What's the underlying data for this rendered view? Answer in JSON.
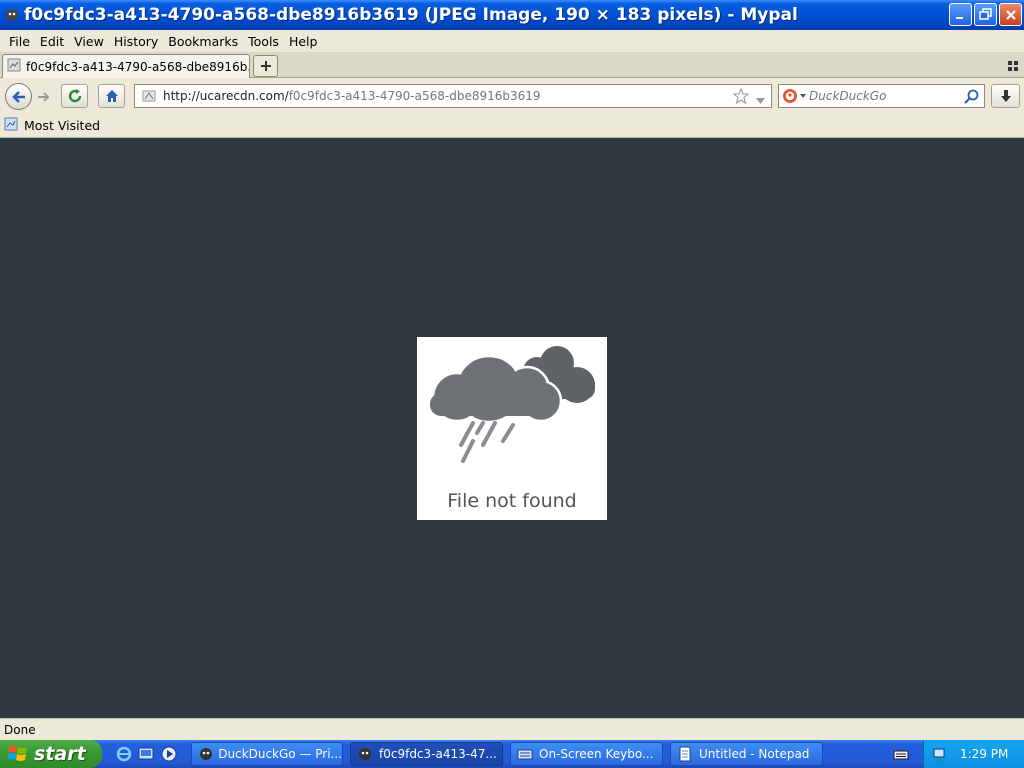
{
  "window": {
    "title": "f0c9fdc3-a413-4790-a568-dbe8916b3619 (JPEG Image, 190 × 183 pixels) - Mypal"
  },
  "menu": [
    "File",
    "Edit",
    "View",
    "History",
    "Bookmarks",
    "Tools",
    "Help"
  ],
  "tab": {
    "label": "f0c9fdc3-a413-4790-a568-dbe8916b..."
  },
  "nav": {
    "url_host": "http://ucarecdn.com/",
    "url_path": "f0c9fdc3-a413-4790-a568-dbe8916b3619",
    "search_placeholder": "DuckDuckGo"
  },
  "bookmarks": {
    "most_visited": "Most Visited"
  },
  "content": {
    "message": "File not found"
  },
  "status": {
    "text": "Done"
  },
  "taskbar": {
    "start": "start",
    "tasks": [
      {
        "label": "DuckDuckGo — Pri..."
      },
      {
        "label": "f0c9fdc3-a413-47..."
      },
      {
        "label": "On-Screen Keybo..."
      },
      {
        "label": "Untitled - Notepad"
      }
    ],
    "clock": "1:29 PM"
  },
  "colors": {
    "content_bg": "#2e3a40",
    "titlebar_blue": "#0052d6",
    "start_green": "#3c9a36",
    "cloud_gray": "#6e7175"
  }
}
